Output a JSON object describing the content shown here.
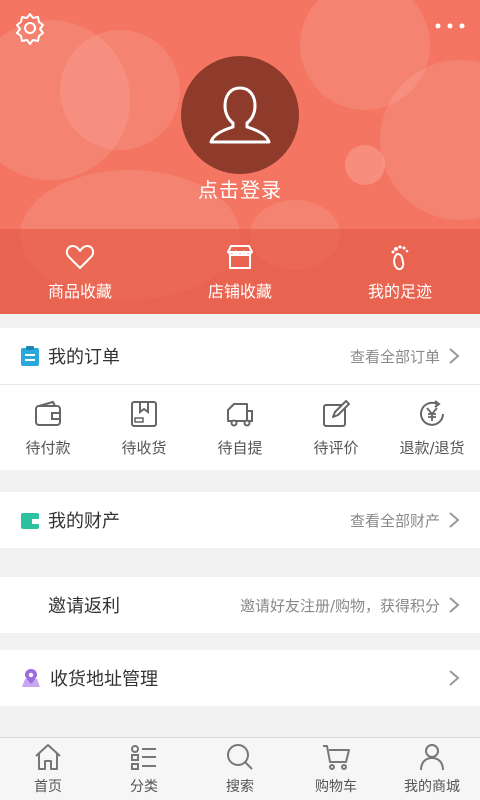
{
  "header": {
    "login_text": "点击登录",
    "favorites": [
      {
        "label": "商品收藏",
        "icon": "heart-icon"
      },
      {
        "label": "店铺收藏",
        "icon": "store-icon"
      },
      {
        "label": "我的足迹",
        "icon": "footprint-icon"
      }
    ],
    "accent_color": "#f47561"
  },
  "orders": {
    "title": "我的订单",
    "view_all": "查看全部订单",
    "items": [
      {
        "label": "待付款",
        "icon": "wallet-icon"
      },
      {
        "label": "待收货",
        "icon": "package-icon"
      },
      {
        "label": "待自提",
        "icon": "truck-icon"
      },
      {
        "label": "待评价",
        "icon": "edit-icon"
      },
      {
        "label": "退款/退货",
        "icon": "refund-icon"
      }
    ]
  },
  "assets": {
    "title": "我的财产",
    "view_all": "查看全部财产"
  },
  "invite": {
    "title": "邀请返利",
    "desc": "邀请好友注册/购物，获得积分"
  },
  "address": {
    "title": "收货地址管理"
  },
  "tabbar": {
    "items": [
      {
        "label": "首页",
        "icon": "home-icon"
      },
      {
        "label": "分类",
        "icon": "category-icon"
      },
      {
        "label": "搜索",
        "icon": "search-icon"
      },
      {
        "label": "购物车",
        "icon": "cart-icon"
      },
      {
        "label": "我的商城",
        "icon": "user-icon"
      }
    ]
  }
}
